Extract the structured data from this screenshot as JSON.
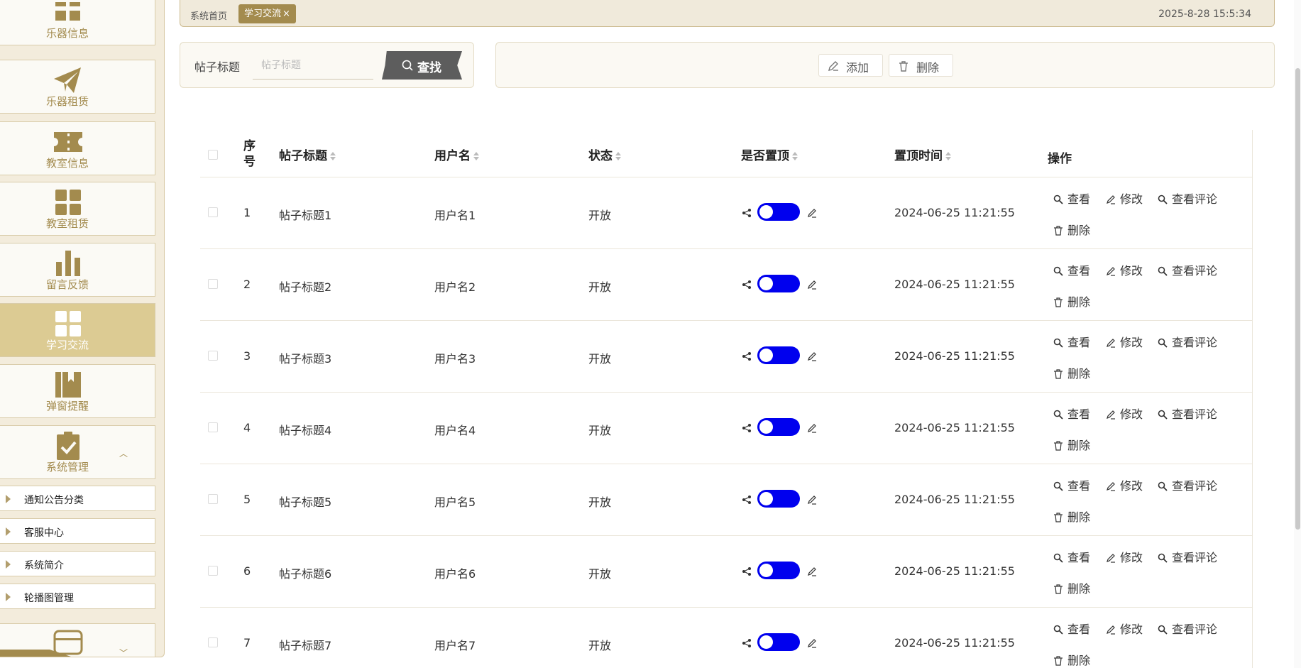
{
  "sidebar": {
    "items": [
      {
        "label": "乐器信息",
        "icon": "instrument-info-icon"
      },
      {
        "label": "乐器租赁",
        "icon": "paper-plane-icon"
      },
      {
        "label": "教室信息",
        "icon": "ticket-icon"
      },
      {
        "label": "教室租赁",
        "icon": "grid-icon"
      },
      {
        "label": "留言反馈",
        "icon": "bar-chart-icon"
      },
      {
        "label": "学习交流",
        "icon": "grid-icon",
        "active": true
      },
      {
        "label": "弹窗提醒",
        "icon": "bookmark-icon"
      },
      {
        "label": "系统管理",
        "icon": "clipboard-check-icon"
      }
    ],
    "sub_items": [
      "通知公告分类",
      "客服中心",
      "系统简介",
      "轮播图管理"
    ]
  },
  "topbar": {
    "home_tab": "系统首页",
    "active_tab": "学习交流",
    "close_symbol": "×",
    "datetime": "2025-8-28 15:5:34"
  },
  "search": {
    "label": "帖子标题",
    "placeholder": "帖子标题",
    "button": "查找"
  },
  "actions": {
    "add": "添加",
    "delete": "删除"
  },
  "table": {
    "headers": {
      "index": "序号",
      "title": "帖子标题",
      "username": "用户名",
      "status": "状态",
      "pinned": "是否置顶",
      "pin_time": "置顶时间",
      "ops": "操作"
    },
    "op_labels": {
      "view": "查看",
      "edit": "修改",
      "comments": "查看评论",
      "delete": "删除"
    },
    "rows": [
      {
        "index": "1",
        "title": "帖子标题1",
        "username": "用户名1",
        "status": "开放",
        "pinned": true,
        "pin_time": "2024-06-25 11:21:55"
      },
      {
        "index": "2",
        "title": "帖子标题2",
        "username": "用户名2",
        "status": "开放",
        "pinned": true,
        "pin_time": "2024-06-25 11:21:55"
      },
      {
        "index": "3",
        "title": "帖子标题3",
        "username": "用户名3",
        "status": "开放",
        "pinned": true,
        "pin_time": "2024-06-25 11:21:55"
      },
      {
        "index": "4",
        "title": "帖子标题4",
        "username": "用户名4",
        "status": "开放",
        "pinned": true,
        "pin_time": "2024-06-25 11:21:55"
      },
      {
        "index": "5",
        "title": "帖子标题5",
        "username": "用户名5",
        "status": "开放",
        "pinned": true,
        "pin_time": "2024-06-25 11:21:55"
      },
      {
        "index": "6",
        "title": "帖子标题6",
        "username": "用户名6",
        "status": "开放",
        "pinned": true,
        "pin_time": "2024-06-25 11:21:55"
      },
      {
        "index": "7",
        "title": "帖子标题7",
        "username": "用户名7",
        "status": "开放",
        "pinned": true,
        "pin_time": "2024-06-25 11:21:55"
      }
    ]
  },
  "colors": {
    "accent": "#a38b4e",
    "sidebar_active": "#dccb93",
    "switch_on": "#0000ee",
    "search_button": "#5d5d5d"
  }
}
